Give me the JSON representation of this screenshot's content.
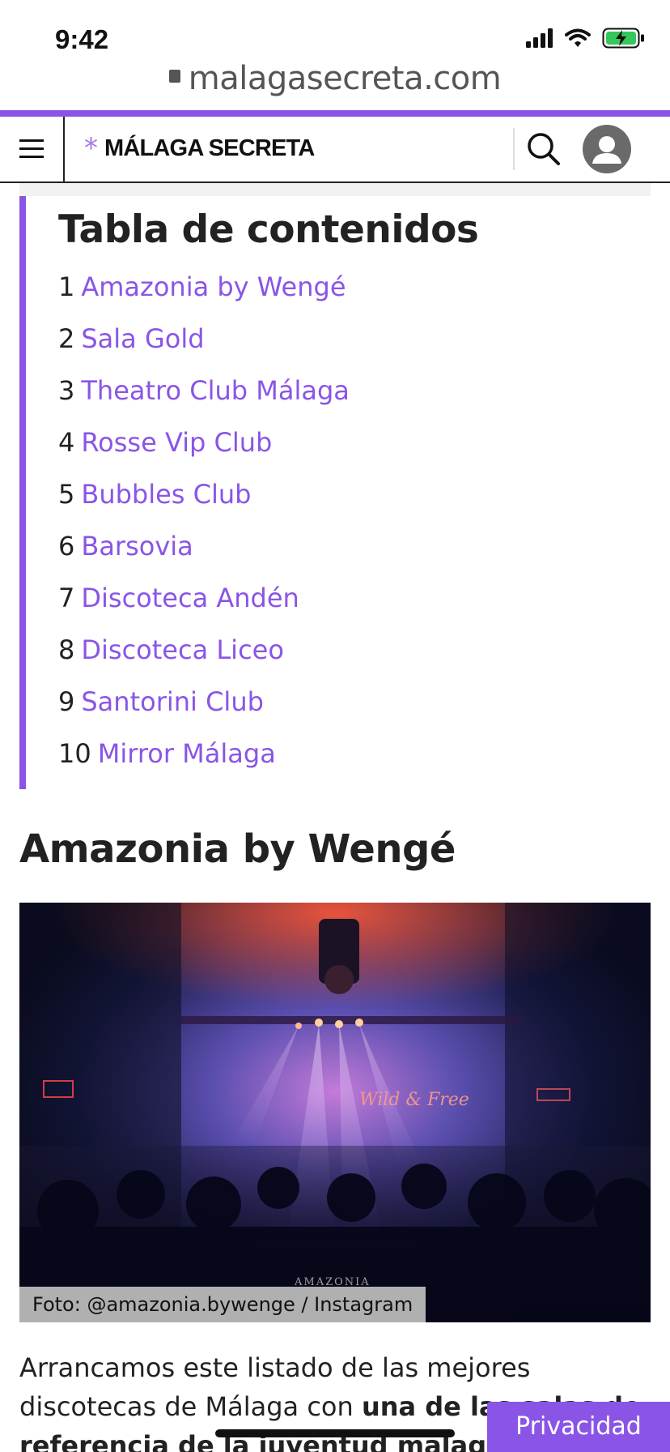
{
  "status_bar": {
    "time": "9:42"
  },
  "browser": {
    "url": "malagasecreta.com"
  },
  "header": {
    "logo_star": "*",
    "logo_text": "MÁLAGA SECRETA"
  },
  "toc": {
    "title": "Tabla de contenidos",
    "items": [
      {
        "num": "1",
        "label": "Amazonia by Wengé"
      },
      {
        "num": "2",
        "label": "Sala Gold"
      },
      {
        "num": "3",
        "label": "Theatro Club Málaga"
      },
      {
        "num": "4",
        "label": "Rosse Vip Club"
      },
      {
        "num": "5",
        "label": "Bubbles Club"
      },
      {
        "num": "6",
        "label": "Barsovia"
      },
      {
        "num": "7",
        "label": "Discoteca Andén"
      },
      {
        "num": "8",
        "label": "Discoteca Liceo"
      },
      {
        "num": "9",
        "label": "Santorini Club"
      },
      {
        "num": "10",
        "label": "Mirror Málaga"
      }
    ]
  },
  "article": {
    "heading": "Amazonia by Wengé",
    "photo_caption": "Foto: @amazonia.bywenge / Instagram",
    "photo_sign_text": "Wild & Free",
    "photo_watermark": "AMAZONIA",
    "paragraph_start": "Arrancamos este listado de las mejores discotecas de Málaga con ",
    "paragraph_bold": "una de las salas de referencia de la juventud malagueña"
  },
  "privacy_button": "Privacidad",
  "colors": {
    "accent": "#8a55e6",
    "logo_star": "#a678ea",
    "battery": "#34c759"
  },
  "icons": [
    "signal-icon",
    "wifi-icon",
    "battery-charging-icon",
    "lock-icon",
    "hamburger-menu-icon",
    "search-icon",
    "user-avatar-icon"
  ]
}
